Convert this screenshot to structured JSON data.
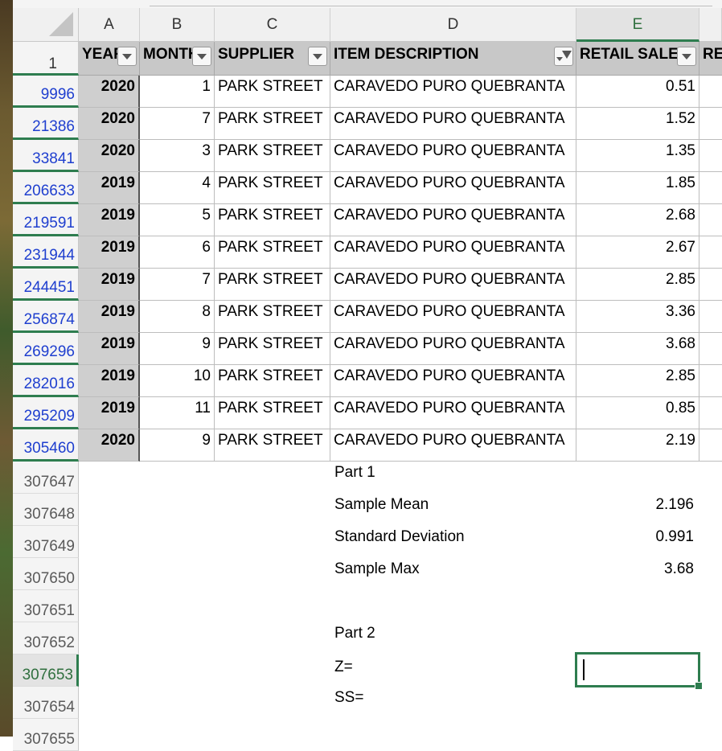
{
  "columns": [
    "A",
    "B",
    "C",
    "D",
    "E"
  ],
  "header_row_number": "1",
  "headers": {
    "year": "YEAR",
    "month": "MONTH",
    "supplier": "SUPPLIER",
    "item": "ITEM DESCRIPTION",
    "retail": "RETAIL SALES",
    "next": "RE"
  },
  "rows": [
    {
      "num": "9996",
      "year": "2020",
      "month": "1",
      "supplier": "PARK STREET",
      "item": "CARAVEDO PURO QUEBRANTA",
      "retail": "0.51"
    },
    {
      "num": "21386",
      "year": "2020",
      "month": "7",
      "supplier": "PARK STREET",
      "item": "CARAVEDO PURO QUEBRANTA",
      "retail": "1.52"
    },
    {
      "num": "33841",
      "year": "2020",
      "month": "3",
      "supplier": "PARK STREET",
      "item": "CARAVEDO PURO QUEBRANTA",
      "retail": "1.35"
    },
    {
      "num": "206633",
      "year": "2019",
      "month": "4",
      "supplier": "PARK STREET",
      "item": "CARAVEDO PURO QUEBRANTA",
      "retail": "1.85"
    },
    {
      "num": "219591",
      "year": "2019",
      "month": "5",
      "supplier": "PARK STREET",
      "item": "CARAVEDO PURO QUEBRANTA",
      "retail": "2.68"
    },
    {
      "num": "231944",
      "year": "2019",
      "month": "6",
      "supplier": "PARK STREET",
      "item": "CARAVEDO PURO QUEBRANTA",
      "retail": "2.67"
    },
    {
      "num": "244451",
      "year": "2019",
      "month": "7",
      "supplier": "PARK STREET",
      "item": "CARAVEDO PURO QUEBRANTA",
      "retail": "2.85"
    },
    {
      "num": "256874",
      "year": "2019",
      "month": "8",
      "supplier": "PARK STREET",
      "item": "CARAVEDO PURO QUEBRANTA",
      "retail": "3.36"
    },
    {
      "num": "269296",
      "year": "2019",
      "month": "9",
      "supplier": "PARK STREET",
      "item": "CARAVEDO PURO QUEBRANTA",
      "retail": "3.68"
    },
    {
      "num": "282016",
      "year": "2019",
      "month": "10",
      "supplier": "PARK STREET",
      "item": "CARAVEDO PURO QUEBRANTA",
      "retail": "2.85"
    },
    {
      "num": "295209",
      "year": "2019",
      "month": "11",
      "supplier": "PARK STREET",
      "item": "CARAVEDO PURO QUEBRANTA",
      "retail": "0.85"
    },
    {
      "num": "305460",
      "year": "2020",
      "month": "9",
      "supplier": "PARK STREET",
      "item": "CARAVEDO PURO QUEBRANTA",
      "retail": "2.19"
    }
  ],
  "extra_rows": [
    "307647",
    "307648",
    "307649",
    "307650",
    "307651",
    "307652",
    "307653",
    "307654",
    "307655"
  ],
  "part1": {
    "title": "Part 1",
    "mean_label": "Sample Mean",
    "mean_value": "2.196",
    "sd_label": "Standard Deviation",
    "sd_value": "0.991",
    "max_label": "Sample Max",
    "max_value": "3.68"
  },
  "part2": {
    "title": "Part 2",
    "z_label": "Z=",
    "ss_label": "SS="
  },
  "colors": {
    "selection": "#2e7d4f",
    "filtered_row_number": "#1f3fcf",
    "header_fill": "#c8c8c8"
  },
  "active_cell": "E307653"
}
